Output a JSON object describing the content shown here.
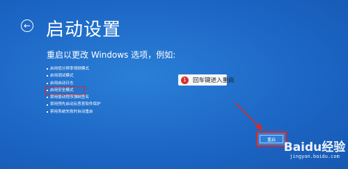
{
  "window": {
    "title": "启动设置",
    "back_icon": "back-arrow-icon"
  },
  "intro": "重启以更改 Windows 选项，例如:",
  "options": [
    "启用低分辨率视频模式",
    "启用调试模式",
    "启用启动日志",
    "启用安全模式",
    "禁用驱动程序强制签名",
    "禁用预先启动反恶意软件保护",
    "禁用系统失败时自动重启"
  ],
  "highlighted_option_index": 3,
  "annotation": {
    "number": "1",
    "text": "回车键进入重启"
  },
  "restart_button": {
    "label": "重启"
  },
  "watermark": {
    "logo": "Baidu经验",
    "url": "jingyan.baidu.com"
  },
  "colors": {
    "background": "#1d67c6",
    "highlight": "#e2251f",
    "annotation_badge": "#d9302a"
  }
}
